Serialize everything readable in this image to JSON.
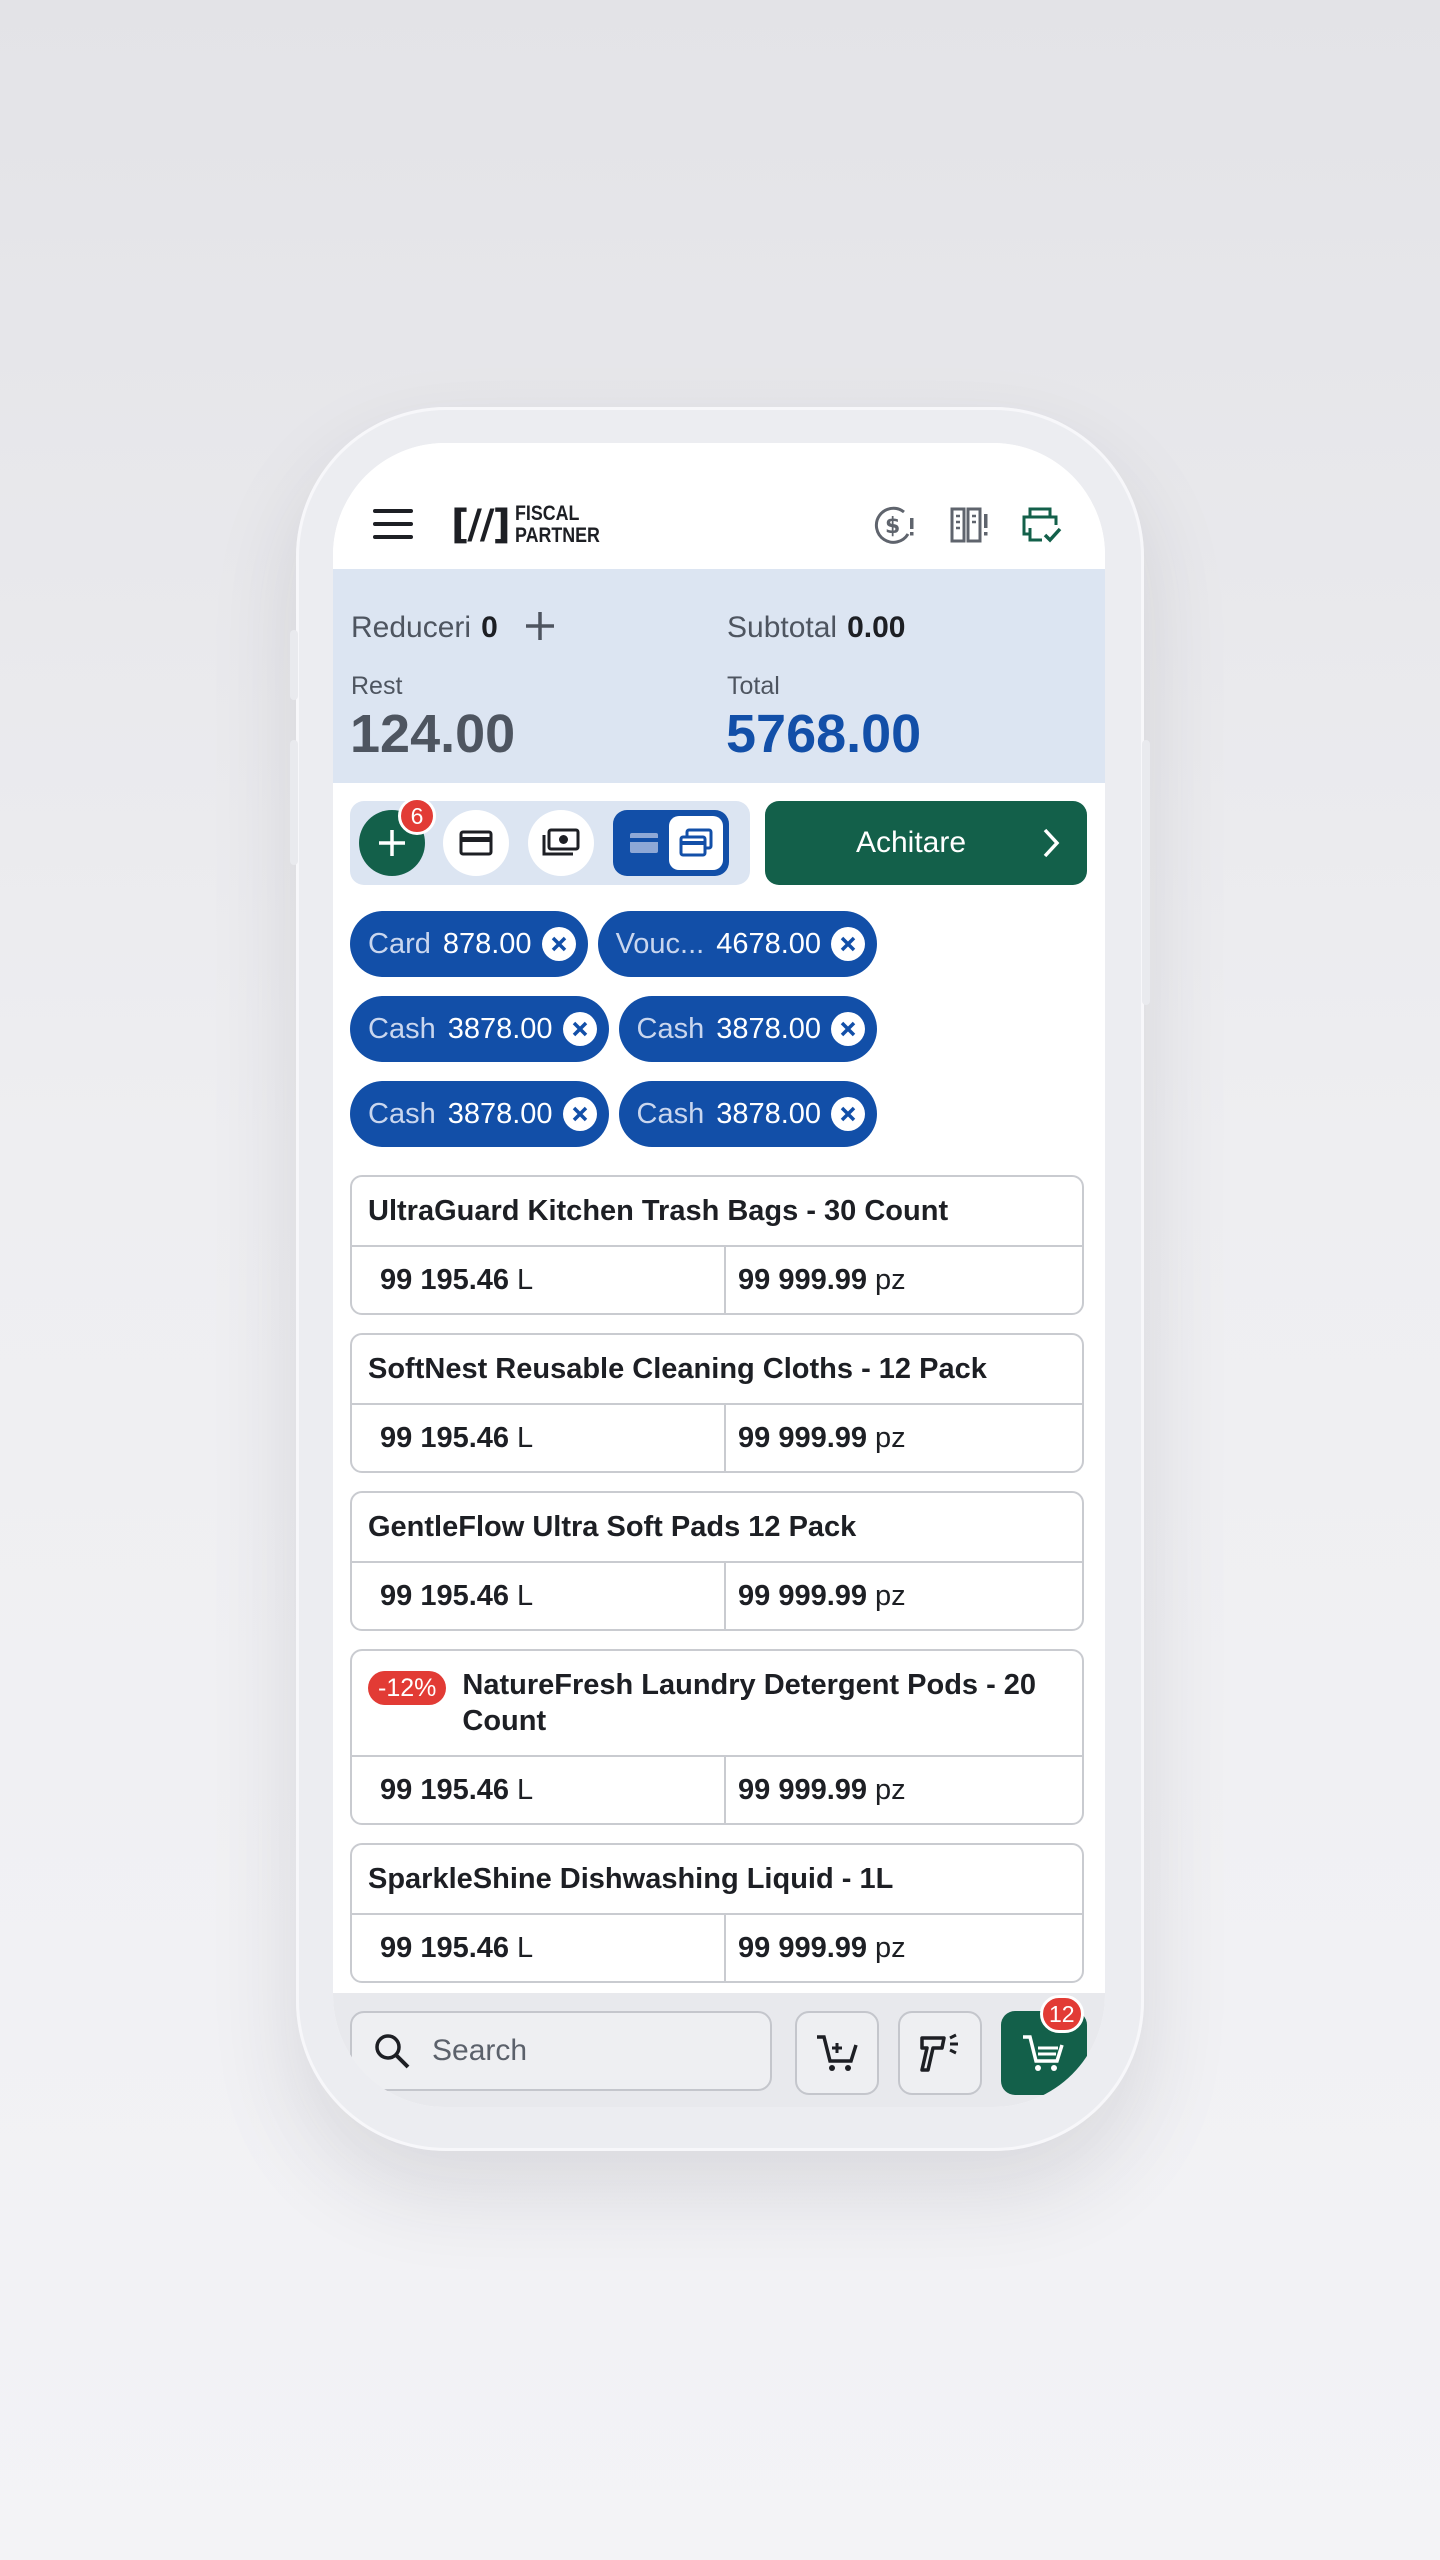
{
  "header": {
    "logo_mark": "[//]",
    "logo_line1": "FISCAL",
    "logo_line2": "PARTNER",
    "icons": [
      "menu-icon",
      "currency-alert-icon",
      "receipt-alert-icon",
      "printer-check-icon"
    ]
  },
  "summary": {
    "reduceri_label": "Reduceri",
    "reduceri_value": "0",
    "subtotal_label": "Subtotal",
    "subtotal_value": "0.00",
    "rest_label": "Rest",
    "rest_value": "124.00",
    "total_label": "Total",
    "total_value": "5768.00"
  },
  "toolbar": {
    "add_badge": "6",
    "pay_label": "Achitare"
  },
  "payments": [
    {
      "name": "Card",
      "amount": "878.00"
    },
    {
      "name": "Vouc...",
      "amount": "4678.00"
    },
    {
      "name": "Cash",
      "amount": "3878.00"
    },
    {
      "name": "Cash",
      "amount": "3878.00"
    },
    {
      "name": "Cash",
      "amount": "3878.00"
    },
    {
      "name": "Cash",
      "amount": "3878.00"
    }
  ],
  "products": [
    {
      "title": "UltraGuard Kitchen Trash Bags - 30 Count",
      "discount": "",
      "price": "99 195.46",
      "price_unit": "L",
      "qty": "99 999.99",
      "qty_unit": "pz"
    },
    {
      "title": "SoftNest Reusable Cleaning Cloths - 12 Pack",
      "discount": "",
      "price": "99 195.46",
      "price_unit": "L",
      "qty": "99 999.99",
      "qty_unit": "pz"
    },
    {
      "title": "GentleFlow Ultra Soft Pads 12 Pack",
      "discount": "",
      "price": "99 195.46",
      "price_unit": "L",
      "qty": "99 999.99",
      "qty_unit": "pz"
    },
    {
      "title": "NatureFresh Laundry Detergent Pods - 20 Count",
      "discount": "-12%",
      "price": "99 195.46",
      "price_unit": "L",
      "qty": "99 999.99",
      "qty_unit": "pz"
    },
    {
      "title": "SparkleShine Dishwashing Liquid - 1L",
      "discount": "",
      "price": "99 195.46",
      "price_unit": "L",
      "qty": "99 999.99",
      "qty_unit": "pz"
    }
  ],
  "bottom": {
    "search_placeholder": "Search",
    "cart_badge": "12"
  },
  "colors": {
    "brand_green": "#13604a",
    "brand_blue": "#124fa8",
    "summary_bg": "#dce5f2",
    "badge_red": "#e23b35"
  }
}
